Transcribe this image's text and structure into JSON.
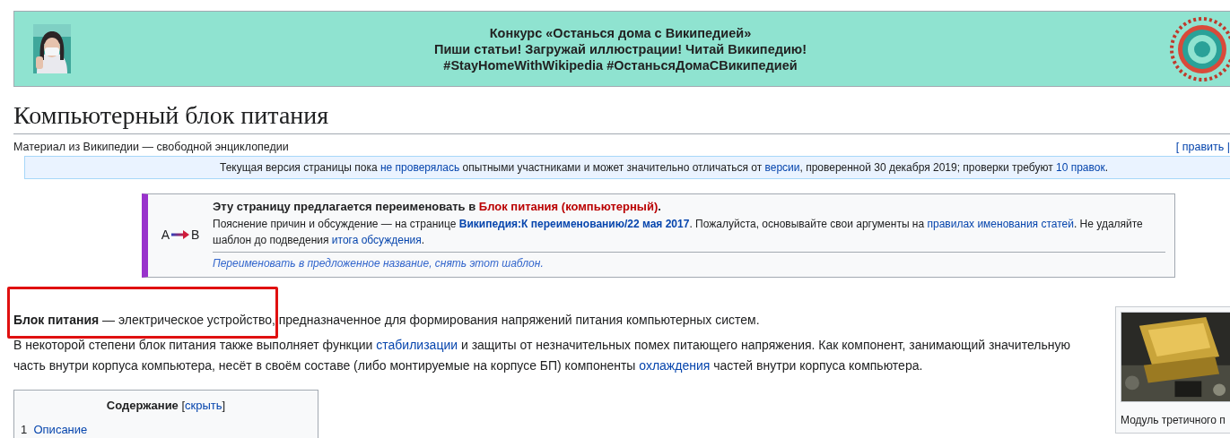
{
  "banner": {
    "title_lines": [
      "Конкурс «Останься дома с Википедией»",
      "Пиши статьи! Загружай иллюстрации! Читай Википедию!",
      "#StayHomeWithWikipedia #ОстаньсяДомаСВикипедией"
    ]
  },
  "page": {
    "title": "Компьютерный блок питания",
    "tagline": "Материал из Википедии — свободной энциклопедии",
    "edit_link": "[ править |"
  },
  "notice": [
    {
      "kind": "text",
      "text": "Текущая версия страницы пока "
    },
    {
      "kind": "link",
      "text": "не проверялась"
    },
    {
      "kind": "text",
      "text": " опытными участниками и может значительно отличаться от "
    },
    {
      "kind": "link",
      "text": "версии"
    },
    {
      "kind": "text",
      "text": ", проверенной 30 декабря 2019; проверки требуют "
    },
    {
      "kind": "link",
      "text": "10 правок"
    },
    {
      "kind": "text",
      "text": "."
    }
  ],
  "rename_notice": {
    "icon_from": "A",
    "icon_to": "B",
    "title": [
      {
        "kind": "bold",
        "text": "Эту страницу предлагается переименовать в "
      },
      {
        "kind": "redlink",
        "text": "Блок питания (компьютерный)"
      },
      {
        "kind": "bold",
        "text": "."
      }
    ],
    "body": [
      {
        "kind": "text",
        "text": "Пояснение причин и обсуждение — на странице "
      },
      {
        "kind": "boldlink",
        "text": "Википедия:К переименованию/22 мая 2017"
      },
      {
        "kind": "text",
        "text": ". Пожалуйста, основывайте свои аргументы на "
      },
      {
        "kind": "link",
        "text": "правилах именования статей"
      },
      {
        "kind": "text",
        "text": ". Не удаляйте шаблон до подведения "
      },
      {
        "kind": "link",
        "text": "итога обсуждения"
      },
      {
        "kind": "text",
        "text": "."
      }
    ],
    "footer_link": "Переименовать в предложенное название, снять этот шаблон."
  },
  "paragraphs": [
    [
      {
        "kind": "bold",
        "text": "Блок питания"
      },
      {
        "kind": "text",
        "text": " — электрическое устройство, предназначенное для формирования напряжений питания компьютерных систем."
      }
    ],
    [
      {
        "kind": "text",
        "text": "В некоторой степени блок питания также выполняет функции "
      },
      {
        "kind": "link",
        "text": "стабилизации"
      },
      {
        "kind": "text",
        "text": " и защиты от незначительных помех питающего напряжения. Как компонент, занимающий значительную часть внутри корпуса компьютера, несёт в своём составе (либо монтируемые на корпусе БП) компоненты "
      },
      {
        "kind": "link",
        "text": "охлаждения"
      },
      {
        "kind": "text",
        "text": " частей внутри корпуса компьютера."
      }
    ]
  ],
  "toc": {
    "title": "Содержание",
    "toggle_open": "[",
    "toggle": "скрыть",
    "toggle_close": "]",
    "items": [
      {
        "number": "1",
        "label": "Описание"
      }
    ]
  },
  "thumbnail": {
    "caption": "Модуль третичного п"
  },
  "annotation": {
    "kind": "highlight-box"
  }
}
